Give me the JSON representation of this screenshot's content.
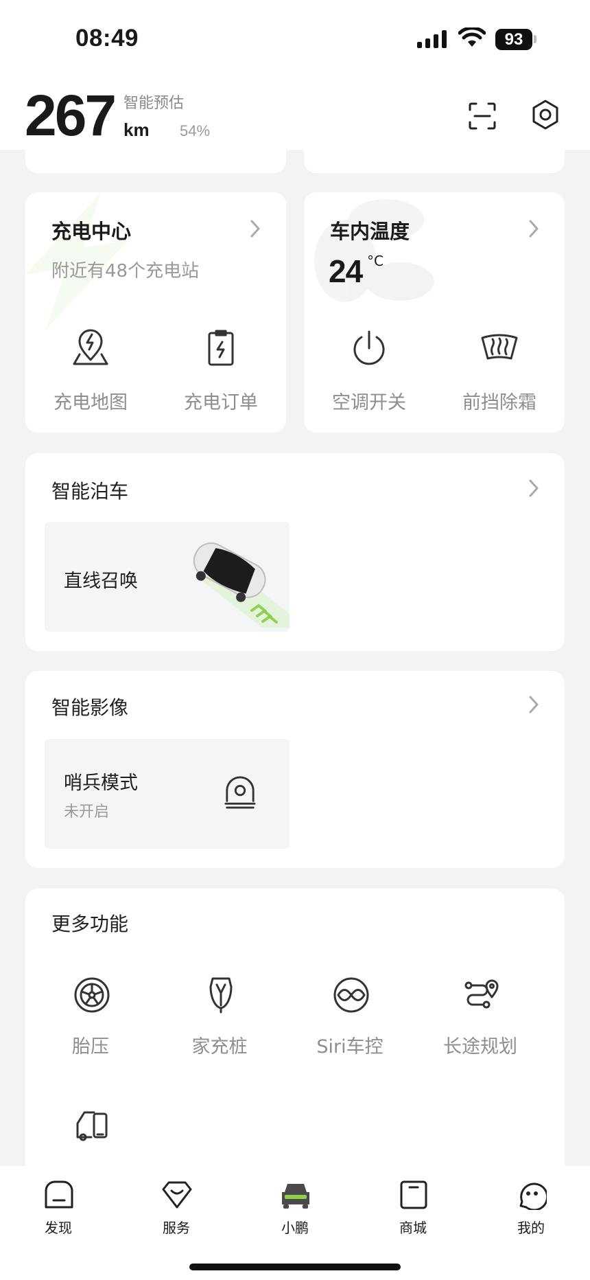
{
  "status_bar": {
    "time": "08:49",
    "battery": "93"
  },
  "header": {
    "range_value": "267",
    "range_label": "智能预估",
    "range_unit": "km",
    "battery_percent": "54%",
    "scan_icon": "scan-icon",
    "settings_icon": "hex-settings-icon"
  },
  "charging_card": {
    "title": "充电中心",
    "subtitle": "附近有48个充电站",
    "actions": [
      {
        "label": "充电地图",
        "icon": "charge-map-icon"
      },
      {
        "label": "充电订单",
        "icon": "charge-order-icon"
      }
    ]
  },
  "climate_card": {
    "title": "车内温度",
    "temperature": "24",
    "temperature_unit": "°C",
    "actions": [
      {
        "label": "空调开关",
        "icon": "power-icon"
      },
      {
        "label": "前挡除霜",
        "icon": "defrost-icon"
      }
    ]
  },
  "parking_card": {
    "title": "智能泊车",
    "tile": {
      "title": "直线召唤",
      "image": "car-image"
    }
  },
  "camera_card": {
    "title": "智能影像",
    "tile": {
      "title": "哨兵模式",
      "subtitle": "未开启",
      "icon": "sentry-camera-icon"
    }
  },
  "more_card": {
    "title": "更多功能",
    "items": [
      {
        "label": "胎压",
        "icon": "tire-icon"
      },
      {
        "label": "家充桩",
        "icon": "home-charger-icon"
      },
      {
        "label": "Siri车控",
        "icon": "siri-icon"
      },
      {
        "label": "长途规划",
        "icon": "route-icon"
      },
      {
        "label": "",
        "icon": "vehicle-device-icon"
      }
    ]
  },
  "tabbar": {
    "tabs": [
      {
        "label": "发现",
        "icon": "discover-icon"
      },
      {
        "label": "服务",
        "icon": "service-icon"
      },
      {
        "label": "小鹏",
        "icon": "car-tab-icon",
        "active": true
      },
      {
        "label": "商城",
        "icon": "store-icon"
      },
      {
        "label": "我的",
        "icon": "profile-icon"
      }
    ]
  },
  "colors": {
    "accent_green": "#8fd14f",
    "background": "#f3f3f3",
    "card": "#ffffff",
    "text_secondary": "#8e8e8e"
  }
}
